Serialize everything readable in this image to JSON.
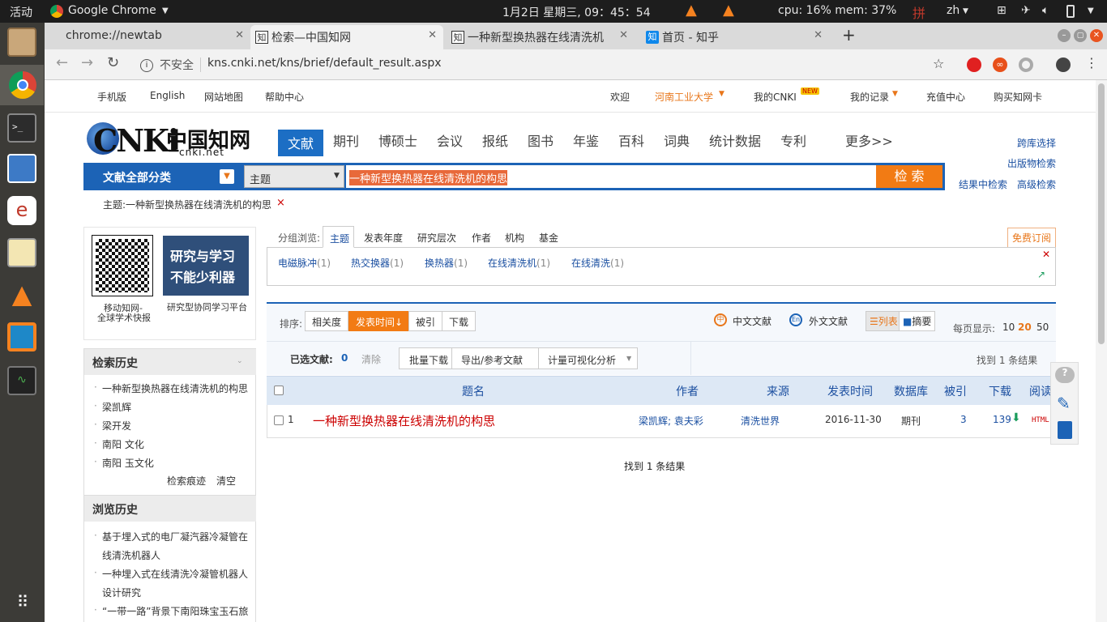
{
  "system": {
    "activities": "活动",
    "app": "Google Chrome",
    "clock": "1月2日 星期三, 09：45：54",
    "cpu": "cpu: 16% mem: 37%",
    "input": "拼",
    "lang": "zh"
  },
  "tabs": [
    {
      "title": "chrome://newtab"
    },
    {
      "title": "检索—中国知网"
    },
    {
      "title": "一种新型换热器在线清洗机"
    },
    {
      "title": "首页 - 知乎"
    }
  ],
  "address": {
    "security": "不安全",
    "url": "kns.cnki.net/kns/brief/default_result.aspx"
  },
  "topnav": {
    "mobile": "手机版",
    "english": "English",
    "sitemap": "网站地图",
    "help": "帮助中心",
    "welcome": "欢迎",
    "org": "河南工业大学",
    "mycnki": "我的CNKI",
    "myrecord": "我的记录",
    "recharge": "充值中心",
    "buycard": "购买知网卡",
    "new_badge": "NEW"
  },
  "logo": {
    "cn": "中国知网",
    "en": "cnki.net"
  },
  "categories": [
    "文献",
    "期刊",
    "博硕士",
    "会议",
    "报纸",
    "图书",
    "年鉴",
    "百科",
    "词典",
    "统计数据",
    "专利",
    "更多>>"
  ],
  "search": {
    "category_btn": "文献全部分类",
    "field": "主题",
    "query": "一种新型换热器在线清洗机的构思",
    "button": "检 索"
  },
  "right_links": {
    "cross": "跨库选择",
    "publish": "出版物检索",
    "inresult": "结果中检索",
    "advanced": "高级检索"
  },
  "crumb": {
    "text": "主题:一种新型换热器在线清洗机的构思",
    "close": "×"
  },
  "promo": {
    "qr_caption1": "移动知网-",
    "qr_caption2": "全球学术快报",
    "banner1": "研究与学习",
    "banner2": "不能少利器",
    "banner_caption": "研究型协同学习平台"
  },
  "search_history": {
    "title": "检索历史",
    "items": [
      "一种新型换热器在线清洗机的构思",
      "梁凯辉",
      "梁开发",
      "南阳 文化",
      "南阳 玉文化"
    ],
    "trace": "检索痕迹",
    "clear": "清空"
  },
  "browse_history": {
    "title": "浏览历史",
    "items": [
      "基于埋入式的电厂凝汽器冷凝管在",
      "线清洗机器人",
      "一种埋入式在线清洗冷凝管机器人",
      "设计研究",
      "“一带一路”背景下南阳珠宝玉石旅"
    ]
  },
  "group": {
    "label": "分组浏览:",
    "tabs": [
      "主题",
      "发表年度",
      "研究层次",
      "作者",
      "机构",
      "基金"
    ],
    "subscribe": "免费订阅",
    "terms": [
      {
        "t": "电磁脉冲",
        "c": "(1)"
      },
      {
        "t": "热交换器",
        "c": "(1)"
      },
      {
        "t": "换热器",
        "c": "(1)"
      },
      {
        "t": "在线清洗机",
        "c": "(1)"
      },
      {
        "t": "在线清洗",
        "c": "(1)"
      }
    ]
  },
  "sort": {
    "label": "排序:",
    "options": [
      "相关度",
      "发表时间",
      "被引",
      "下载"
    ],
    "zh": "中文文献",
    "en": "外文文献",
    "list": "列表",
    "abstract": "摘要",
    "perpage_label": "每页显示:",
    "perpage": [
      "10",
      "20",
      "50"
    ]
  },
  "selected": {
    "label": "已选文献:",
    "count": "0",
    "clear": "清除",
    "batch": "批量下载",
    "export": "导出/参考文献",
    "viz": "计量可视化分析",
    "found": "找到 1 条结果"
  },
  "table": {
    "headers": [
      "题名",
      "作者",
      "来源",
      "发表时间",
      "数据库",
      "被引",
      "下载",
      "阅读"
    ],
    "rows": [
      {
        "no": "1",
        "title": "一种新型换热器在线清洗机的构思",
        "authors": "梁凯辉; 袁夫彩",
        "source": "清洗世界",
        "date": "2016-11-30",
        "db": "期刊",
        "cited": "3",
        "downloads": "139",
        "read": "HTML"
      }
    ]
  },
  "footer_found": "找到 1 条结果",
  "colors": {
    "accent": "#1c63b6",
    "orange": "#f27b14",
    "red": "#cc0000"
  }
}
